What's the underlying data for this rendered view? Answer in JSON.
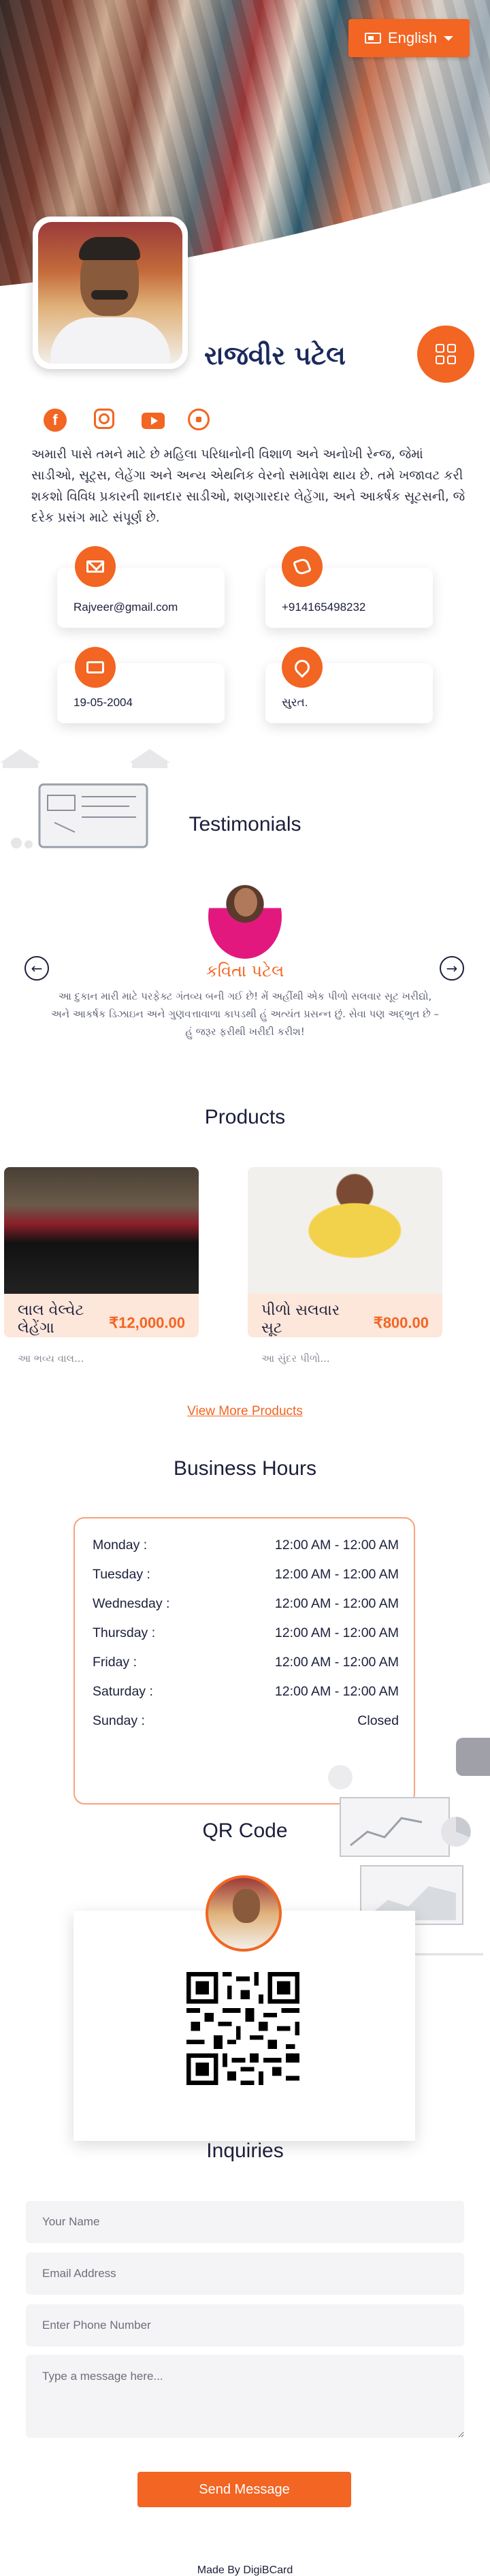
{
  "header": {
    "language_label": "English"
  },
  "profile": {
    "name": "રાજવીર પટેલ",
    "about": "અમારી પાસે તમને માટે છે મહિલા પરિધાનોની વિશાળ અને અનોખી રેન્જ, જેમાં સાડીઓ, સૂટ્સ, લેહેંગા અને અન્ય એથનિક વેરનો સમાવેશ થાય છે. તમે ખજાવટ કરી શકશો વિવિધ પ્રકારની શાનદાર સાડીઓ, શણગારદાર લેહેંગા, અને આકર્ષક સૂટસની, જે દરેક પ્રસંગ માટે સંપૂર્ણ છે."
  },
  "social": [
    "facebook-icon",
    "instagram-icon",
    "youtube-icon",
    "whatsapp-icon"
  ],
  "contact": {
    "email": "Rajveer@gmail.com",
    "phone": "+914165498232",
    "dob": "19-05-2004",
    "location": "સુરત."
  },
  "testimonials": {
    "title": "Testimonials",
    "name": "કવિતા પટેલ",
    "text": "આ દુકાન મારી માટે પરફેક્ટ ગંતવ્ય બની ગઈ છે! મેં અહીંથી એક પીળો સલવાર સૂટ ખરીદ્યો, અને આકર્ષક ડિઝાઇન અને ગુણવત્તાવાળા કાપડથી હું અત્યંત પ્રસન્ન છું. સેવા પણ અદ્ભુત છે – હું જરૂર ફરીથી ખરીદી કરીશ!"
  },
  "products": {
    "title": "Products",
    "items": [
      {
        "name": "લાલ વેલ્વેટ લેહેંગા",
        "desc": "આ ભવ્ય વાલ...",
        "price": "₹12,000.00"
      },
      {
        "name": "પીળો સલવાર સૂટ",
        "desc": "આ સુંદર પીળો...",
        "price": "₹800.00"
      }
    ],
    "more_label": "View More Products"
  },
  "hours": {
    "title": "Business Hours",
    "rows": [
      {
        "day": "Monday :",
        "time": "12:00 AM - 12:00 AM"
      },
      {
        "day": "Tuesday :",
        "time": "12:00 AM - 12:00 AM"
      },
      {
        "day": "Wednesday :",
        "time": "12:00 AM - 12:00 AM"
      },
      {
        "day": "Thursday :",
        "time": "12:00 AM - 12:00 AM"
      },
      {
        "day": "Friday :",
        "time": "12:00 AM - 12:00 AM"
      },
      {
        "day": "Saturday :",
        "time": "12:00 AM - 12:00 AM"
      },
      {
        "day": "Sunday :",
        "time": "Closed"
      }
    ]
  },
  "qr": {
    "title": "QR Code"
  },
  "inquiries": {
    "title": "Inquiries",
    "name_placeholder": "Your Name",
    "email_placeholder": "Email Address",
    "phone_placeholder": "Enter Phone Number",
    "message_placeholder": "Type a message here...",
    "send_label": "Send Message"
  },
  "footer": {
    "text": "Made By DigiBCard"
  },
  "colors": {
    "accent": "#f26522",
    "dark": "#1b1f3b"
  }
}
